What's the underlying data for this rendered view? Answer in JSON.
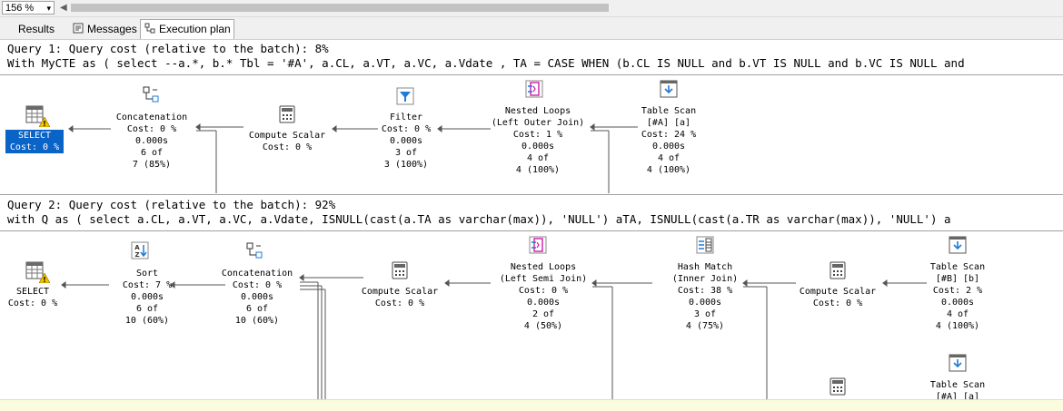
{
  "toolbar": {
    "zoom": "156 %"
  },
  "tabs": [
    {
      "label": "Results",
      "active": false
    },
    {
      "label": "Messages",
      "active": false
    },
    {
      "label": "Execution plan",
      "active": true
    }
  ],
  "queries": [
    {
      "header": "Query 1: Query cost (relative to the batch): 8%",
      "sql": "With MyCTE as ( select --a.*, b.* Tbl = '#A', a.CL, a.VT, a.VC, a.Vdate , TA = CASE WHEN (b.CL IS NULL and b.VT IS NULL and b.VC IS NULL and",
      "nodes": {
        "select": {
          "line1": "SELECT",
          "line2": "Cost: 0 %"
        },
        "concat": {
          "op": "Concatenation",
          "cost": "Cost: 0 %",
          "time": "0.000s",
          "rows": "6 of",
          "est": "7 (85%)"
        },
        "compute": {
          "op": "Compute Scalar",
          "cost": "Cost: 0 %"
        },
        "filter": {
          "op": "Filter",
          "cost": "Cost: 0 %",
          "time": "0.000s",
          "rows": "3 of",
          "est": "3 (100%)"
        },
        "nested": {
          "op": "Nested Loops",
          "op2": "(Left Outer Join)",
          "cost": "Cost: 1 %",
          "time": "0.000s",
          "rows": "4 of",
          "est": "4 (100%)"
        },
        "scan": {
          "op": "Table Scan",
          "obj": "[#A] [a]",
          "cost": "Cost: 24 %",
          "time": "0.000s",
          "rows": "4 of",
          "est": "4 (100%)"
        }
      }
    },
    {
      "header": "Query 2: Query cost (relative to the batch): 92%",
      "sql": "with Q as ( select a.CL, a.VT, a.VC, a.Vdate, ISNULL(cast(a.TA as varchar(max)), 'NULL') aTA, ISNULL(cast(a.TR as varchar(max)), 'NULL') a",
      "nodes": {
        "select": {
          "line1": "SELECT",
          "line2": "Cost: 0 %"
        },
        "sort": {
          "op": "Sort",
          "cost": "Cost: 7 %",
          "time": "0.000s",
          "rows": "6 of",
          "est": "10 (60%)"
        },
        "concat": {
          "op": "Concatenation",
          "cost": "Cost: 0 %",
          "time": "0.000s",
          "rows": "6 of",
          "est": "10 (60%)"
        },
        "compute1": {
          "op": "Compute Scalar",
          "cost": "Cost: 0 %"
        },
        "nested": {
          "op": "Nested Loops",
          "op2": "(Left Semi Join)",
          "cost": "Cost: 0 %",
          "time": "0.000s",
          "rows": "2 of",
          "est": "4 (50%)"
        },
        "hash": {
          "op": "Hash Match",
          "op2": "(Inner Join)",
          "cost": "Cost: 38 %",
          "time": "0.000s",
          "rows": "3 of",
          "est": "4 (75%)"
        },
        "compute2": {
          "op": "Compute Scalar",
          "cost": "Cost: 0 %"
        },
        "scanb": {
          "op": "Table Scan",
          "obj": "[#B] [b]",
          "cost": "Cost: 2 %",
          "time": "0.000s",
          "rows": "4 of",
          "est": "4 (100%)"
        },
        "scana": {
          "op": "Table Scan",
          "obj": "[#A] [a]"
        }
      }
    }
  ],
  "colors": {
    "selection": "#0a64c8",
    "warning": "#f2c200",
    "accent": "#1f7bd8",
    "magenta": "#d01ca8"
  }
}
